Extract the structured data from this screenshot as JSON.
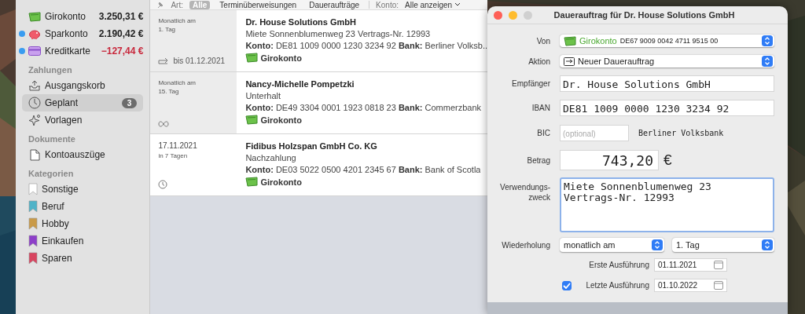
{
  "sidebar": {
    "accounts": [
      {
        "kind": "giro",
        "label": "Girokonto",
        "balance": "3.250,31 €",
        "negative": false,
        "unread": false
      },
      {
        "kind": "savings",
        "label": "Sparkonto",
        "balance": "2.190,42 €",
        "negative": false,
        "unread": true
      },
      {
        "kind": "credit",
        "label": "Kreditkarte",
        "balance": "−127,44 €",
        "negative": true,
        "unread": true
      }
    ],
    "sections": [
      {
        "title": "Zahlungen",
        "items": [
          {
            "kind": "outbox",
            "label": "Ausgangskorb",
            "selected": false
          },
          {
            "kind": "clock",
            "label": "Geplant",
            "selected": true,
            "badge": "3"
          },
          {
            "kind": "sparkle",
            "label": "Vorlagen",
            "selected": false
          }
        ]
      },
      {
        "title": "Dokumente",
        "items": [
          {
            "kind": "document",
            "label": "Kontoauszüge",
            "selected": false
          }
        ]
      },
      {
        "title": "Kategorien",
        "items": [
          {
            "kind": "bookmark",
            "label": "Sonstige",
            "selected": false,
            "color": "#ffffff"
          },
          {
            "kind": "bookmark",
            "label": "Beruf",
            "selected": false,
            "color": "#4fb3c8"
          },
          {
            "kind": "bookmark",
            "label": "Hobby",
            "selected": false,
            "color": "#c99a48"
          },
          {
            "kind": "bookmark",
            "label": "Einkaufen",
            "selected": false,
            "color": "#8d3fc9"
          },
          {
            "kind": "bookmark",
            "label": "Sparen",
            "selected": false,
            "color": "#d84560"
          }
        ]
      }
    ]
  },
  "filter_bar": {
    "label": "Art:",
    "options": [
      {
        "label": "Alle",
        "selected": true
      },
      {
        "label": "Terminüberweisungen",
        "selected": false
      },
      {
        "label": "Daueraufträge",
        "selected": false
      }
    ],
    "account_label": "Konto:",
    "account_value": "Alle anzeigen"
  },
  "payments": [
    {
      "kind": "standing",
      "when": "Monatlich am",
      "when_note": "1. Tag",
      "end": "bis 01.12.2021",
      "payee": "Dr. House Solutions GmbH",
      "purpose": "Miete Sonnenblumenweg 23 Vertrags-Nr. 12993",
      "details": "**Konto:** DE81 1009 0000 1230 3234 92  **Bank:** Berliner Volksb..",
      "account": "Girokonto"
    },
    {
      "kind": "standing",
      "when": "Monatlich am",
      "when_note": "15. Tag",
      "payee": "Nancy-Michelle Pompetzki",
      "purpose": "Unterhalt",
      "details": "**Konto:** DE49 3304 0001 1923 0818 23  **Bank:** Commerzbank",
      "account": "Girokonto"
    },
    {
      "kind": "scheduled",
      "when": "17.11.2021",
      "when_note": "in 7 Tagen",
      "payee": "Fidibus Holzspan GmbH Co. KG",
      "purpose": "Nachzahlung",
      "details": "**Konto:** DE03 5022 0500 4201 2345 67  **Bank:** Bank of Scotla",
      "account": "Girokonto"
    }
  ],
  "dialog": {
    "title": "Dauerauftrag für Dr. House Solutions GmbH",
    "fields": [
      {
        "kind": "account",
        "label": "Von",
        "account": "Girokonto",
        "iban": "DE67 9009 0042 4711 9515 00"
      },
      {
        "kind": "popup",
        "label": "Aktion",
        "value": "Neuer Dauerauftrag"
      },
      {
        "kind": "text",
        "label": "Empfänger",
        "value": "Dr. House Solutions GmbH"
      },
      {
        "kind": "text",
        "label": "IBAN",
        "value": "DE81 1009 0000 1230 3234 92"
      },
      {
        "kind": "bic",
        "label": "BIC",
        "placeholder": "(optional)",
        "bank": "Berliner Volksbank"
      },
      {
        "kind": "amount",
        "label": "Betrag",
        "value": "743,20",
        "currency": "€"
      },
      {
        "kind": "textarea",
        "label": "Verwendungs-\nzweck",
        "value": "Miete Sonnenblumenweg 23\nVertrags-Nr. 12993",
        "focused": true
      },
      {
        "kind": "repeat",
        "label": "Wiederholung",
        "interval": "monatlich am",
        "day": "1. Tag"
      },
      {
        "kind": "date",
        "label": "Erste Ausführung",
        "value": "01.11.2021"
      },
      {
        "kind": "date",
        "label": "Letzte Ausführung",
        "value": "01.10.2022",
        "checked": true
      }
    ]
  }
}
